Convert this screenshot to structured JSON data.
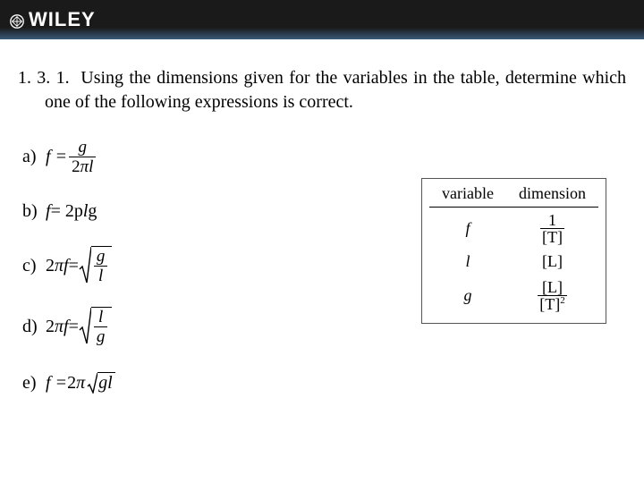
{
  "brand": "WILEY",
  "question": {
    "number": "1. 3. 1.",
    "text": "Using the dimensions given for the variables in the table, determine which one of the following expressions is correct."
  },
  "options": {
    "a": {
      "label": "a)",
      "lhs": "f =",
      "num": "g",
      "den_prefix": "2",
      "den_sym": "π",
      "den_var": "l"
    },
    "b": {
      "label": "b)",
      "text_prefix": "f",
      "text_eq": " = 2p",
      "text_var": "l",
      "text_suffix": "g"
    },
    "c": {
      "label": "c)",
      "lhs_prefix": "2",
      "lhs_sym": "π",
      "lhs_var": "f",
      "lhs_eq": " = ",
      "num": "g",
      "den": "l"
    },
    "d": {
      "label": "d)",
      "lhs_prefix": "2",
      "lhs_sym": "π",
      "lhs_var": "f",
      "lhs_eq": " = ",
      "num": "l",
      "den": "g"
    },
    "e": {
      "label": "e)",
      "lhs": "f = ",
      "coef": "2",
      "sym": "π",
      "rad": "gl"
    }
  },
  "table": {
    "headers": {
      "var": "variable",
      "dim": "dimension"
    },
    "rows": {
      "f": {
        "var": "f",
        "num": "1",
        "den": "[T]"
      },
      "l": {
        "var": "l",
        "dim": "[L]"
      },
      "g": {
        "var": "g",
        "num": "[L]",
        "den": "[T]",
        "exp": "2"
      }
    }
  }
}
